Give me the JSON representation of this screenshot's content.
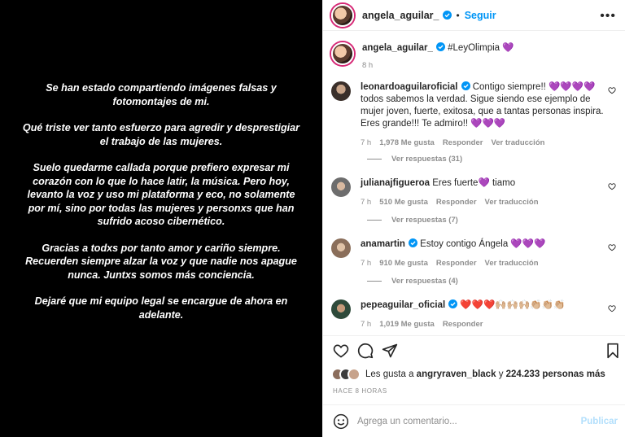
{
  "media": {
    "paragraphs": [
      "Se han estado compartiendo imágenes falsas y fotomontajes de mi.",
      "Qué triste ver tanto esfuerzo para agredir y desprestigiar el trabajo de las mujeres.",
      "Suelo quedarme callada porque prefiero expresar mi corazón con lo que lo hace latir, la música. Pero hoy, levanto la voz y uso mi plataforma y eco, no solamente por mí, sino por todas las mujeres y personxs que han sufrido acoso cibernético.",
      "Gracias a todxs por tanto amor y cariño siempre. Recuerden siempre alzar la voz y que nadie nos apague nunca. Juntxs somos más conciencia.",
      "Dejaré que mi equipo legal se encargue de ahora en adelante."
    ]
  },
  "header": {
    "username": "angela_aguilar_",
    "separator": "•",
    "follow_label": "Seguir",
    "more_label": "•••"
  },
  "caption": {
    "username": "angela_aguilar_",
    "text": "#LeyOlimpia 💜",
    "time": "8 h"
  },
  "comments": [
    {
      "username": "leonardoaguilaroficial",
      "text": "Contigo siempre!! 💜💜💜💜 todos sabemos la verdad. Sigue siendo ese ejemplo de mujer joven, fuerte, exitosa, que a tantas personas inspira. Eres grande!!! Te admiro!! 💜💜💜",
      "time": "7 h",
      "likes": "1,978 Me gusta",
      "reply": "Responder",
      "translate": "Ver traducción",
      "replies": "Ver respuestas (31)"
    },
    {
      "username": "julianajfigueroa",
      "text": "Eres fuerte💜 tiamo",
      "time": "7 h",
      "likes": "510 Me gusta",
      "reply": "Responder",
      "translate": "Ver traducción",
      "replies": "Ver respuestas (7)"
    },
    {
      "username": "anamartin",
      "text": "Estoy contigo Ángela 💜💜💜",
      "time": "7 h",
      "likes": "910 Me gusta",
      "reply": "Responder",
      "translate": "Ver traducción",
      "replies": "Ver respuestas (4)"
    },
    {
      "username": "pepeaguilar_oficial",
      "text": "❤️❤️❤️🙌🏼🙌🏼🙌🏼👏🏼👏🏼👏🏼",
      "time": "7 h",
      "likes": "1,019 Me gusta",
      "reply": "Responder"
    }
  ],
  "likes_bar": {
    "prefix": "Les gusta a",
    "user": "angryraven_black",
    "conj": "y",
    "count": "224.233 personas más"
  },
  "time_ago": "HACE 8 HORAS",
  "composer": {
    "placeholder": "Agrega un comentario...",
    "post_label": "Publicar"
  },
  "icons": [
    "verified-badge-icon",
    "heart-icon",
    "comment-icon",
    "share-icon",
    "bookmark-icon",
    "emoji-icon",
    "more-icon"
  ],
  "colors": {
    "link": "#0095f6",
    "verified": "#0095f6",
    "muted": "#8e8e8e",
    "post_disabled": "#b2dffc"
  }
}
